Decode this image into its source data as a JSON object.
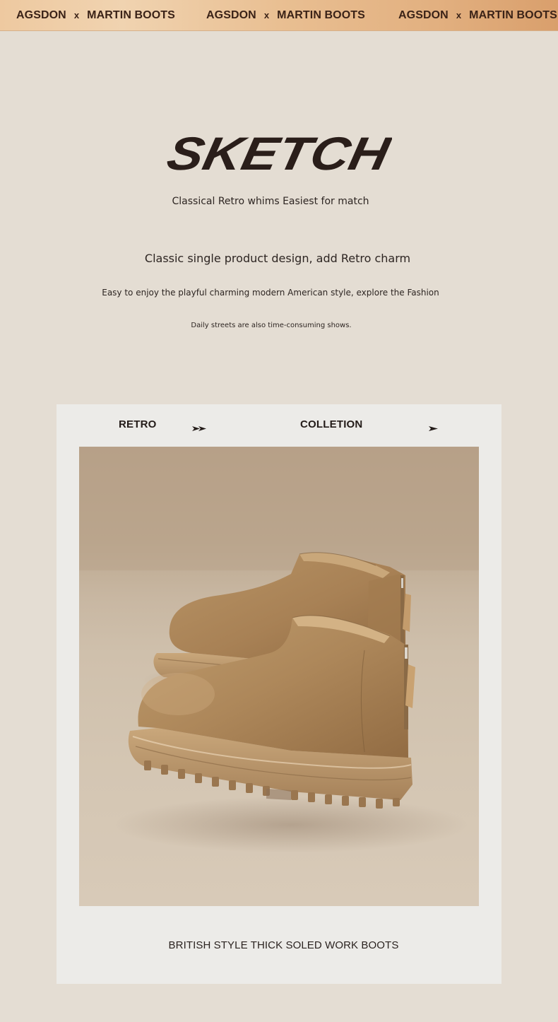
{
  "banner": {
    "groups": [
      {
        "brand": "AGSDON",
        "separator": "x",
        "product": "MARTIN BOOTS"
      },
      {
        "brand": "AGSDON",
        "separator": "x",
        "product": "MARTIN BOOTS"
      },
      {
        "brand": "AGSDON",
        "separator": "x",
        "product": "MARTIN BOOTS"
      }
    ]
  },
  "hero": {
    "logo_text": "SKETCH",
    "tagline": "Classical Retro whims Easiest for match",
    "headline": "Classic single product design, add Retro charm",
    "description": "Easy to enjoy the playful charming modern American style, explore the Fashion",
    "footnote": "Daily streets are also time-consuming shows."
  },
  "card": {
    "header_left": "RETRO",
    "header_right": "COLLETION",
    "header_left_icon": "double-arrow-right-icon",
    "header_right_icon": "arrow-right-icon",
    "photo": "suede-chelsea-boots-photo",
    "caption": "BRITISH STYLE THICK SOLED WORK BOOTS"
  },
  "colors": {
    "page_background": "#e4ddd3",
    "banner_gradient_start": "#eec9a0",
    "banner_gradient_end": "#d99f6c",
    "card_background": "#ecebe8",
    "text_dark": "#2b2320",
    "boot_suede": "#b08a5a"
  }
}
